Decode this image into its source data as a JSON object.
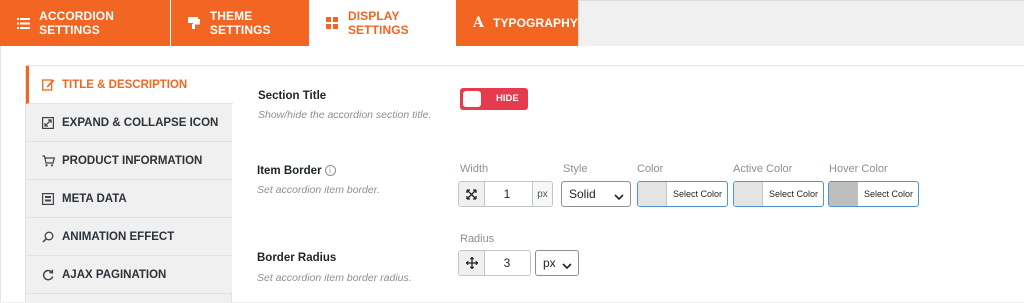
{
  "tabs": [
    {
      "label": "ACCORDION SETTINGS",
      "icon": "list-icon"
    },
    {
      "label": "THEME SETTINGS",
      "icon": "brush-icon"
    },
    {
      "label": "DISPLAY SETTINGS",
      "icon": "grid-icon",
      "active": true
    },
    {
      "label": "TYPOGRAPHY",
      "icon": "font-icon"
    }
  ],
  "sidenav": [
    {
      "label": "TITLE & DESCRIPTION",
      "icon": "edit-icon",
      "active": true
    },
    {
      "label": "EXPAND & COLLAPSE ICON",
      "icon": "expand-icon"
    },
    {
      "label": "PRODUCT INFORMATION",
      "icon": "cart-icon"
    },
    {
      "label": "META DATA",
      "icon": "meta-icon"
    },
    {
      "label": "ANIMATION EFFECT",
      "icon": "animation-icon"
    },
    {
      "label": "AJAX PAGINATION",
      "icon": "refresh-icon"
    }
  ],
  "section_title": {
    "title": "Section Title",
    "desc": "Show/hide the accordion section title.",
    "toggle_label": "HIDE"
  },
  "item_border": {
    "title": "Item Border",
    "info": "i",
    "desc": "Set accordion item border.",
    "width_label": "Width",
    "width_value": "1",
    "width_unit": "px",
    "style_label": "Style",
    "style_value": "Solid",
    "color_label": "Color",
    "color_button": "Select Color",
    "active_color_label": "Active Color",
    "active_color_button": "Select Color",
    "hover_color_label": "Hover Color",
    "hover_color_button": "Select Color"
  },
  "border_radius": {
    "title": "Border Radius",
    "desc": "Set accordion item border radius.",
    "radius_label": "Radius",
    "radius_value": "3",
    "unit_value": "px"
  },
  "colors": {
    "accent": "#f26522",
    "toggle": "#e63a4f"
  }
}
